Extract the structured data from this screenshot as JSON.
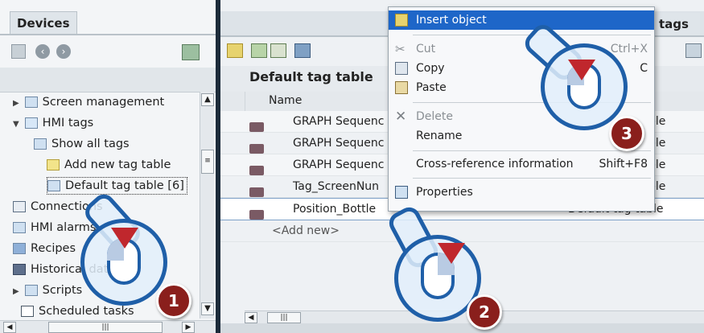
{
  "left_panel": {
    "title": "Devices",
    "tree": [
      {
        "label": "Screen management",
        "icon": "screen-management-icon",
        "arrow": "▶"
      },
      {
        "label": "HMI tags",
        "icon": "hmi-tags-folder-icon",
        "arrow": "▼"
      },
      {
        "label": "Show all tags",
        "icon": "show-all-tags-icon"
      },
      {
        "label": "Add new tag table",
        "icon": "add-tag-table-icon"
      },
      {
        "label": "Default tag table [6]",
        "icon": "tag-table-icon"
      },
      {
        "label": "Connections",
        "icon": "connections-icon"
      },
      {
        "label": "HMI alarms",
        "icon": "hmi-alarms-icon"
      },
      {
        "label": "Recipes",
        "icon": "recipes-icon"
      },
      {
        "label": "Historical data",
        "icon": "historical-data-icon"
      },
      {
        "label": "Scripts",
        "icon": "scripts-icon",
        "arrow": "▶"
      },
      {
        "label": "Scheduled tasks",
        "icon": "scheduled-tasks-icon"
      }
    ],
    "scroll_thumb": "|||"
  },
  "right_panel": {
    "header_tab": "tags",
    "table_title": "Default tag table",
    "column_name": "Name",
    "rows": [
      {
        "name": "GRAPH Sequenc",
        "table": "ble"
      },
      {
        "name": "GRAPH Sequenc",
        "table": "ble"
      },
      {
        "name": "GRAPH Sequenc",
        "table": "ble"
      },
      {
        "name": "Tag_ScreenNun",
        "table": "ble"
      },
      {
        "name": "Position_Bottle",
        "table": "Default tag table"
      }
    ],
    "add_new": "<Add new>",
    "scroll_thumb": "|||"
  },
  "context_menu": {
    "items": {
      "insert": "Insert object",
      "cut": "Cut",
      "cut_shortcut": "Ctrl+X",
      "copy": "Copy",
      "copy_shortcut": "C",
      "paste": "Paste",
      "delete": "Delete",
      "rename": "Rename",
      "xref": "Cross-reference information",
      "xref_shortcut": "Shift+F8",
      "properties": "Properties"
    }
  },
  "callouts": [
    {
      "step": "1"
    },
    {
      "step": "2"
    },
    {
      "step": "3"
    }
  ],
  "colors": {
    "accent": "#1f5fa8",
    "highlight": "#1e66c8",
    "step_badge": "#8a1f1c",
    "pointer_arrow": "#c0272d"
  }
}
